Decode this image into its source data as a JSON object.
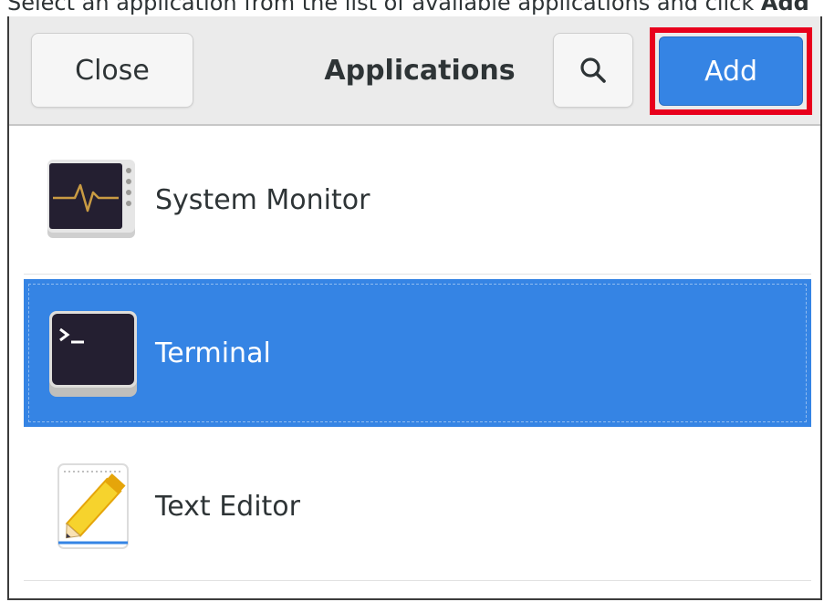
{
  "instruction": {
    "prefix": "Select an application from the list of available applications and click ",
    "emphasis": "Add"
  },
  "dialog": {
    "title": "Applications",
    "close_label": "Close",
    "add_label": "Add",
    "search_icon": "search-icon"
  },
  "apps": [
    {
      "label": "System Monitor",
      "icon": "system-monitor-icon",
      "selected": false
    },
    {
      "label": "Terminal",
      "icon": "terminal-icon",
      "selected": true
    },
    {
      "label": "Text Editor",
      "icon": "text-editor-icon",
      "selected": false
    }
  ],
  "colors": {
    "accent": "#3584e4",
    "highlight": "#e8001c",
    "headerbar": "#ebebeb"
  }
}
